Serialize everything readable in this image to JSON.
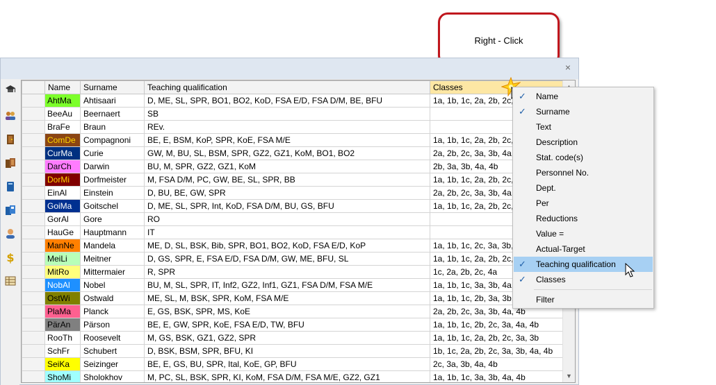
{
  "callout": {
    "text": "Right - Click"
  },
  "columns": [
    {
      "key": "name",
      "label": "Name"
    },
    {
      "key": "surname",
      "label": "Surname"
    },
    {
      "key": "qual",
      "label": "Teaching qualification"
    },
    {
      "key": "classes",
      "label": "Classes"
    }
  ],
  "rows": [
    {
      "name": "AhtMa",
      "bg": "#7cff2a",
      "fg": "#000000",
      "surname": "Ahtisaari",
      "qual": "D, ME, SL, SPR, BO1, BO2, KoD, FSA E/D, FSA D/M, BE, BFU",
      "classes": "1a, 1b, 1c, 2a, 2b, 2c, 3"
    },
    {
      "name": "BeeAu",
      "bg": "",
      "fg": "#000000",
      "surname": "Beernaert",
      "qual": "SB",
      "classes": ""
    },
    {
      "name": "BraFe",
      "bg": "",
      "fg": "#000000",
      "surname": "Braun",
      "qual": "REv.",
      "classes": ""
    },
    {
      "name": "ComDe",
      "bg": "#8b4513",
      "fg": "#ffd700",
      "surname": "Compagnoni",
      "qual": "BE, E, BSM, KoP, SPR, KoE, FSA M/E",
      "classes": "1a, 1b, 1c, 2a, 2b, 2c, 3"
    },
    {
      "name": "CurMa",
      "bg": "#003080",
      "fg": "#ffffff",
      "surname": "Curie",
      "qual": "GW, M, BU, SL, BSM, SPR, GZ2, GZ1, KoM, BO1, BO2",
      "classes": "2a, 2b, 2c, 3a, 3b, 4a, 4"
    },
    {
      "name": "DarCh",
      "bg": "#ff7cff",
      "fg": "#000000",
      "surname": "Darwin",
      "qual": "BU, M, SPR, GZ2, GZ1, KoM",
      "classes": "2b, 3a, 3b, 4a, 4b"
    },
    {
      "name": "DorMi",
      "bg": "#800000",
      "fg": "#ffd700",
      "surname": "Dorfmeister",
      "qual": "M, FSA D/M, PC, GW, BE, SL, SPR, BB",
      "classes": "1a, 1b, 1c, 2a, 2b, 2c, 4"
    },
    {
      "name": "EinAl",
      "bg": "",
      "fg": "#000000",
      "surname": "Einstein",
      "qual": "D, BU, BE, GW, SPR",
      "classes": "2a, 2b, 2c, 3a, 3b, 4a, 4"
    },
    {
      "name": "GoiMa",
      "bg": "#003090",
      "fg": "#ffffff",
      "surname": "Goitschel",
      "qual": "D, ME, SL, SPR, Int, KoD, FSA D/M, BU, GS, BFU",
      "classes": "1a, 1b, 1c, 2a, 2b, 2c, 3"
    },
    {
      "name": "GorAl",
      "bg": "",
      "fg": "#000000",
      "surname": "Gore",
      "qual": "RO",
      "classes": ""
    },
    {
      "name": "HauGe",
      "bg": "",
      "fg": "#000000",
      "surname": "Hauptmann",
      "qual": "IT",
      "classes": ""
    },
    {
      "name": "ManNe",
      "bg": "#ff8000",
      "fg": "#000000",
      "surname": "Mandela",
      "qual": "ME, D, SL, BSK, Bib, SPR, BO1, BO2, KoD, FSA E/D, KoP",
      "classes": "1a, 1b, 1c, 2c, 3a, 3b, 4"
    },
    {
      "name": "MeiLi",
      "bg": "#b8ffb8",
      "fg": "#000000",
      "surname": "Meitner",
      "qual": "D, GS, SPR, E, FSA E/D, FSA D/M, GW, ME, BFU, SL",
      "classes": "1a, 1b, 1c, 2a, 2b, 2c, 3"
    },
    {
      "name": "MitRo",
      "bg": "#ffff7c",
      "fg": "#000000",
      "surname": "Mittermaier",
      "qual": "R, SPR",
      "classes": "1c, 2a, 2b, 2c, 4a"
    },
    {
      "name": "NobAl",
      "bg": "#1e90ff",
      "fg": "#ffffff",
      "surname": "Nobel",
      "qual": "BU, M, SL, SPR, IT, Inf2, GZ2, Inf1, GZ1, FSA D/M, FSA M/E",
      "classes": "1a, 1b, 1c, 3a, 3b, 4a, 4"
    },
    {
      "name": "OstWi",
      "bg": "#808000",
      "fg": "#000000",
      "surname": "Ostwald",
      "qual": "ME, SL, M, BSK, SPR, KoM, FSA M/E",
      "classes": "1a, 1b, 1c, 2b, 3a, 3b, 4"
    },
    {
      "name": "PlaMa",
      "bg": "#ff6090",
      "fg": "#000000",
      "surname": "Planck",
      "qual": "E, GS, BSK, SPR, MS, KoE",
      "classes": "2a, 2b, 2c, 3a, 3b, 4a, 4b"
    },
    {
      "name": "PärAn",
      "bg": "#808080",
      "fg": "#000000",
      "surname": "Pärson",
      "qual": "BE, E, GW, SPR, KoE, FSA E/D, TW, BFU",
      "classes": "1a, 1b, 1c, 2b, 2c, 3a, 4a, 4b"
    },
    {
      "name": "RooTh",
      "bg": "",
      "fg": "#000000",
      "surname": "Roosevelt",
      "qual": "M, GS, BSK, GZ1, GZ2, SPR",
      "classes": "1a, 1b, 1c, 2a, 2b, 2c, 3a, 3b"
    },
    {
      "name": "SchFr",
      "bg": "",
      "fg": "#000000",
      "surname": "Schubert",
      "qual": "D, BSK, BSM, SPR, BFU, KI",
      "classes": "1b, 1c, 2a, 2b, 2c, 3a, 3b, 4a, 4b"
    },
    {
      "name": "SeiKa",
      "bg": "#ffff00",
      "fg": "#000000",
      "surname": "Seizinger",
      "qual": "BE, E, GS, BU, SPR, Ital, KoE, GP, BFU",
      "classes": "2c, 3a, 3b, 4a, 4b"
    },
    {
      "name": "ShoMi",
      "bg": "#a0ffff",
      "fg": "#000000",
      "surname": "Sholokhov",
      "qual": "M, PC, SL, BSK, SPR, KI, KoM, FSA D/M, FSA M/E, GZ2, GZ1",
      "classes": "1a, 1b, 1c, 3a, 3b, 4a, 4b"
    }
  ],
  "menu": [
    {
      "label": "Name",
      "checked": true,
      "highlighted": false
    },
    {
      "label": "Surname",
      "checked": true,
      "highlighted": false
    },
    {
      "label": "Text",
      "checked": false,
      "highlighted": false
    },
    {
      "label": "Description",
      "checked": false,
      "highlighted": false
    },
    {
      "label": "Stat. code(s)",
      "checked": false,
      "highlighted": false
    },
    {
      "label": "Personnel No.",
      "checked": false,
      "highlighted": false
    },
    {
      "label": "Dept.",
      "checked": false,
      "highlighted": false
    },
    {
      "label": "Per",
      "checked": false,
      "highlighted": false
    },
    {
      "label": "Reductions",
      "checked": false,
      "highlighted": false
    },
    {
      "label": "Value =",
      "checked": false,
      "highlighted": false
    },
    {
      "label": "Actual-Target",
      "checked": false,
      "highlighted": false
    },
    {
      "label": "Teaching qualification",
      "checked": true,
      "highlighted": true
    },
    {
      "label": "Classes",
      "checked": true,
      "highlighted": false
    },
    {
      "label": "Filter",
      "checked": false,
      "highlighted": false
    }
  ],
  "toolbar_icons": [
    "graduation-cap-icon",
    "teachers-icon",
    "door-icon",
    "classrooms-icon",
    "book-icon",
    "subjects-icon",
    "person-icon",
    "dollar-icon",
    "table-icon"
  ],
  "colors": {
    "callout_border": "#c0161d",
    "menu_highlight": "#a7d0f3",
    "active_header": "#fde7a4"
  }
}
